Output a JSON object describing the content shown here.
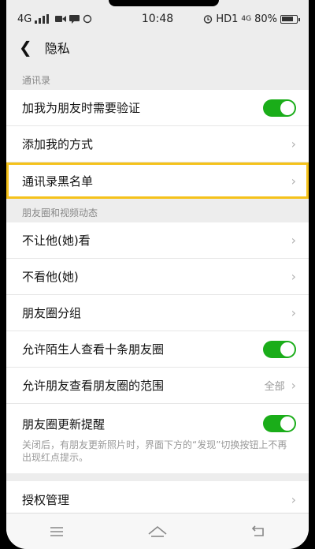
{
  "status": {
    "network": "4G",
    "time": "10:48",
    "hd": "HD1",
    "lte": "4G",
    "battery_percent": "80%",
    "battery_level": 0.8
  },
  "nav": {
    "title": "隐私"
  },
  "sections": {
    "contacts": {
      "title": "通讯录",
      "verify_label": "加我为朋友时需要验证",
      "verify_on": true,
      "add_ways_label": "添加我的方式",
      "blacklist_label": "通讯录黑名单"
    },
    "moments": {
      "title": "朋友圈和视频动态",
      "hide_from_label": "不让他(她)看",
      "dont_see_label": "不看他(她)",
      "groups_label": "朋友圈分组",
      "strangers_label": "允许陌生人查看十条朋友圈",
      "strangers_on": true,
      "range_label": "允许朋友查看朋友圈的范围",
      "range_value": "全部",
      "notify_label": "朋友圈更新提醒",
      "notify_on": true,
      "notify_desc": "关闭后，有朋友更新照片时，界面下方的“发现”切换按钮上不再出现红点提示。"
    },
    "more": {
      "auth_label": "授权管理"
    }
  },
  "colors": {
    "toggle_on": "#1aad19",
    "highlight": "#f5c21b"
  }
}
